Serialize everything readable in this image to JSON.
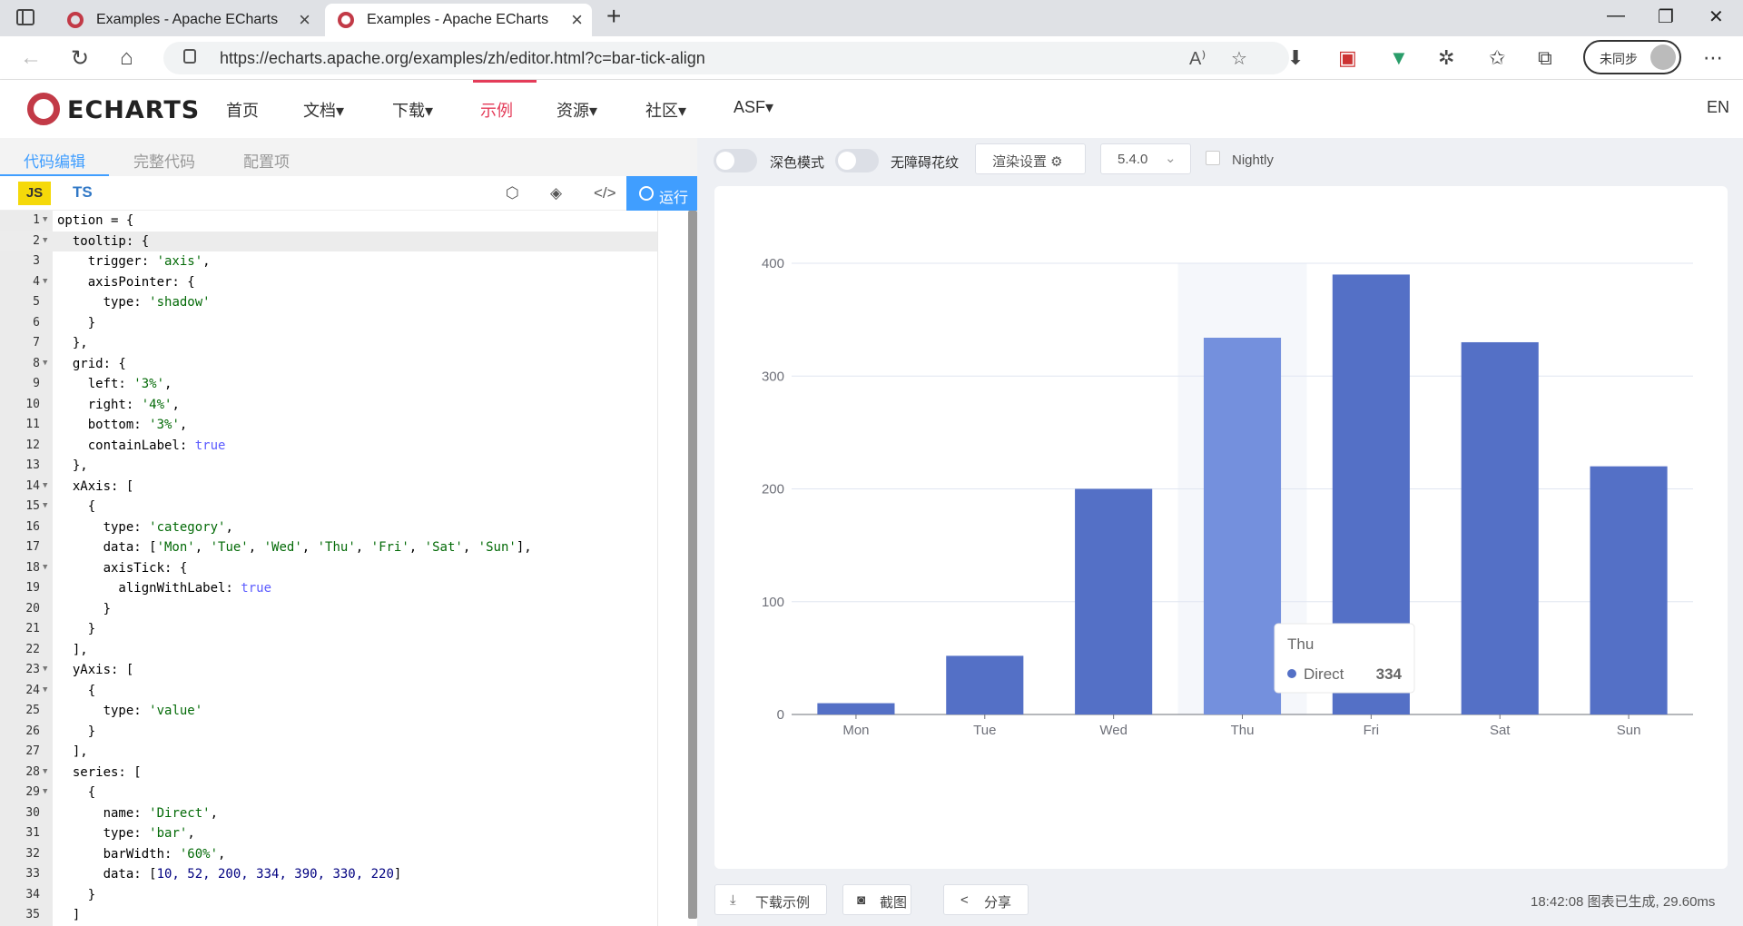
{
  "browser": {
    "tabs": [
      {
        "title": "Examples - Apache ECharts"
      },
      {
        "title": "Examples - Apache ECharts"
      }
    ],
    "url": "https://echarts.apache.org/examples/zh/editor.html?c=bar-tick-align",
    "sync_label": "未同步"
  },
  "site": {
    "logo": "ECHARTS",
    "nav": [
      "首页",
      "文档▾",
      "下载▾",
      "示例",
      "资源▾",
      "社区▾",
      "ASF▾"
    ],
    "lang": "EN"
  },
  "editor": {
    "tabs": [
      "代码编辑",
      "完整代码",
      "配置项"
    ],
    "lang_js": "JS",
    "lang_ts": "TS",
    "run_label": "运行",
    "lines": [
      "option = {",
      "  tooltip: {",
      "    trigger: 'axis',",
      "    axisPointer: {",
      "      type: 'shadow'",
      "    }",
      "  },",
      "  grid: {",
      "    left: '3%',",
      "    right: '4%',",
      "    bottom: '3%',",
      "    containLabel: true",
      "  },",
      "  xAxis: [",
      "    {",
      "      type: 'category',",
      "      data: ['Mon', 'Tue', 'Wed', 'Thu', 'Fri', 'Sat', 'Sun'],",
      "      axisTick: {",
      "        alignWithLabel: true",
      "      }",
      "    }",
      "  ],",
      "  yAxis: [",
      "    {",
      "      type: 'value'",
      "    }",
      "  ],",
      "  series: [",
      "    {",
      "      name: 'Direct',",
      "      type: 'bar',",
      "      barWidth: '60%',",
      "      data: [10, 52, 200, 334, 390, 330, 220]",
      "    }",
      "  ]"
    ]
  },
  "toolbar": {
    "dark_mode": "深色模式",
    "accessible": "无障碍花纹",
    "render_settings": "渲染设置 ⚙",
    "version": "5.4.0",
    "nightly": "Nightly"
  },
  "footer": {
    "download": "下载示例",
    "screenshot": "截图",
    "share": "分享",
    "status": "18:42:08   图表已生成, 29.60ms"
  },
  "chart_data": {
    "type": "bar",
    "categories": [
      "Mon",
      "Tue",
      "Wed",
      "Thu",
      "Fri",
      "Sat",
      "Sun"
    ],
    "series": [
      {
        "name": "Direct",
        "values": [
          10,
          52,
          200,
          334,
          390,
          330,
          220
        ]
      }
    ],
    "ylim": [
      0,
      400
    ],
    "yticks": [
      0,
      100,
      200,
      300,
      400
    ],
    "grid": true,
    "bar_color": "#5470c6",
    "highlight_color": "#7490dd",
    "tooltip": {
      "category": "Thu",
      "series": "Direct",
      "value": "334"
    }
  }
}
